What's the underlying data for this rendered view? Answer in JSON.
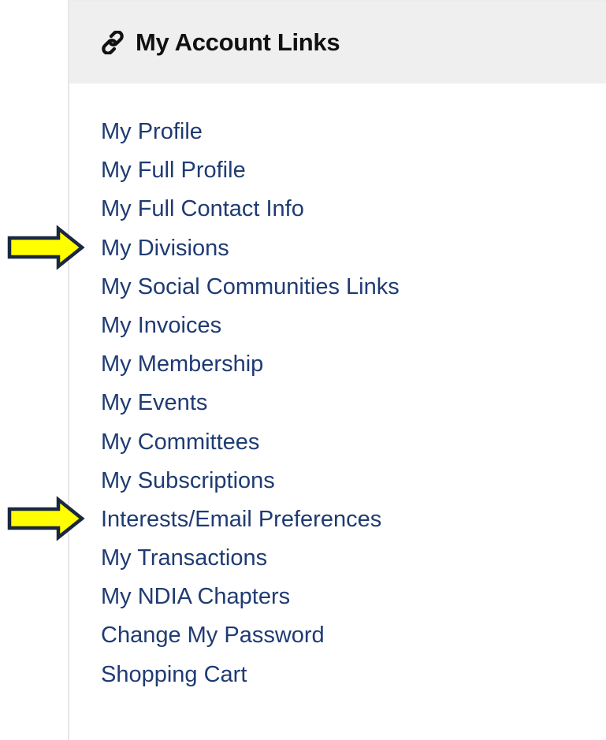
{
  "panel": {
    "title": "My Account Links",
    "title_icon": "link-icon"
  },
  "links": [
    {
      "label": "My Profile"
    },
    {
      "label": "My Full Profile"
    },
    {
      "label": "My Full Contact Info"
    },
    {
      "label": "My Divisions"
    },
    {
      "label": "My Social Communities Links"
    },
    {
      "label": "My Invoices"
    },
    {
      "label": "My Membership"
    },
    {
      "label": "My Events"
    },
    {
      "label": "My Committees"
    },
    {
      "label": "My Subscriptions"
    },
    {
      "label": "Interests/Email Preferences"
    },
    {
      "label": "My Transactions"
    },
    {
      "label": "My NDIA Chapters"
    },
    {
      "label": "Change My Password"
    },
    {
      "label": "Shopping Cart"
    }
  ],
  "annotations": {
    "arrow_color": "#ffff00",
    "arrow_outline": "#1a2740",
    "highlighted_links": [
      "My Divisions",
      "Interests/Email Preferences"
    ]
  },
  "colors": {
    "link": "#1f3b73",
    "header_bg": "#efefef",
    "title": "#111111"
  }
}
